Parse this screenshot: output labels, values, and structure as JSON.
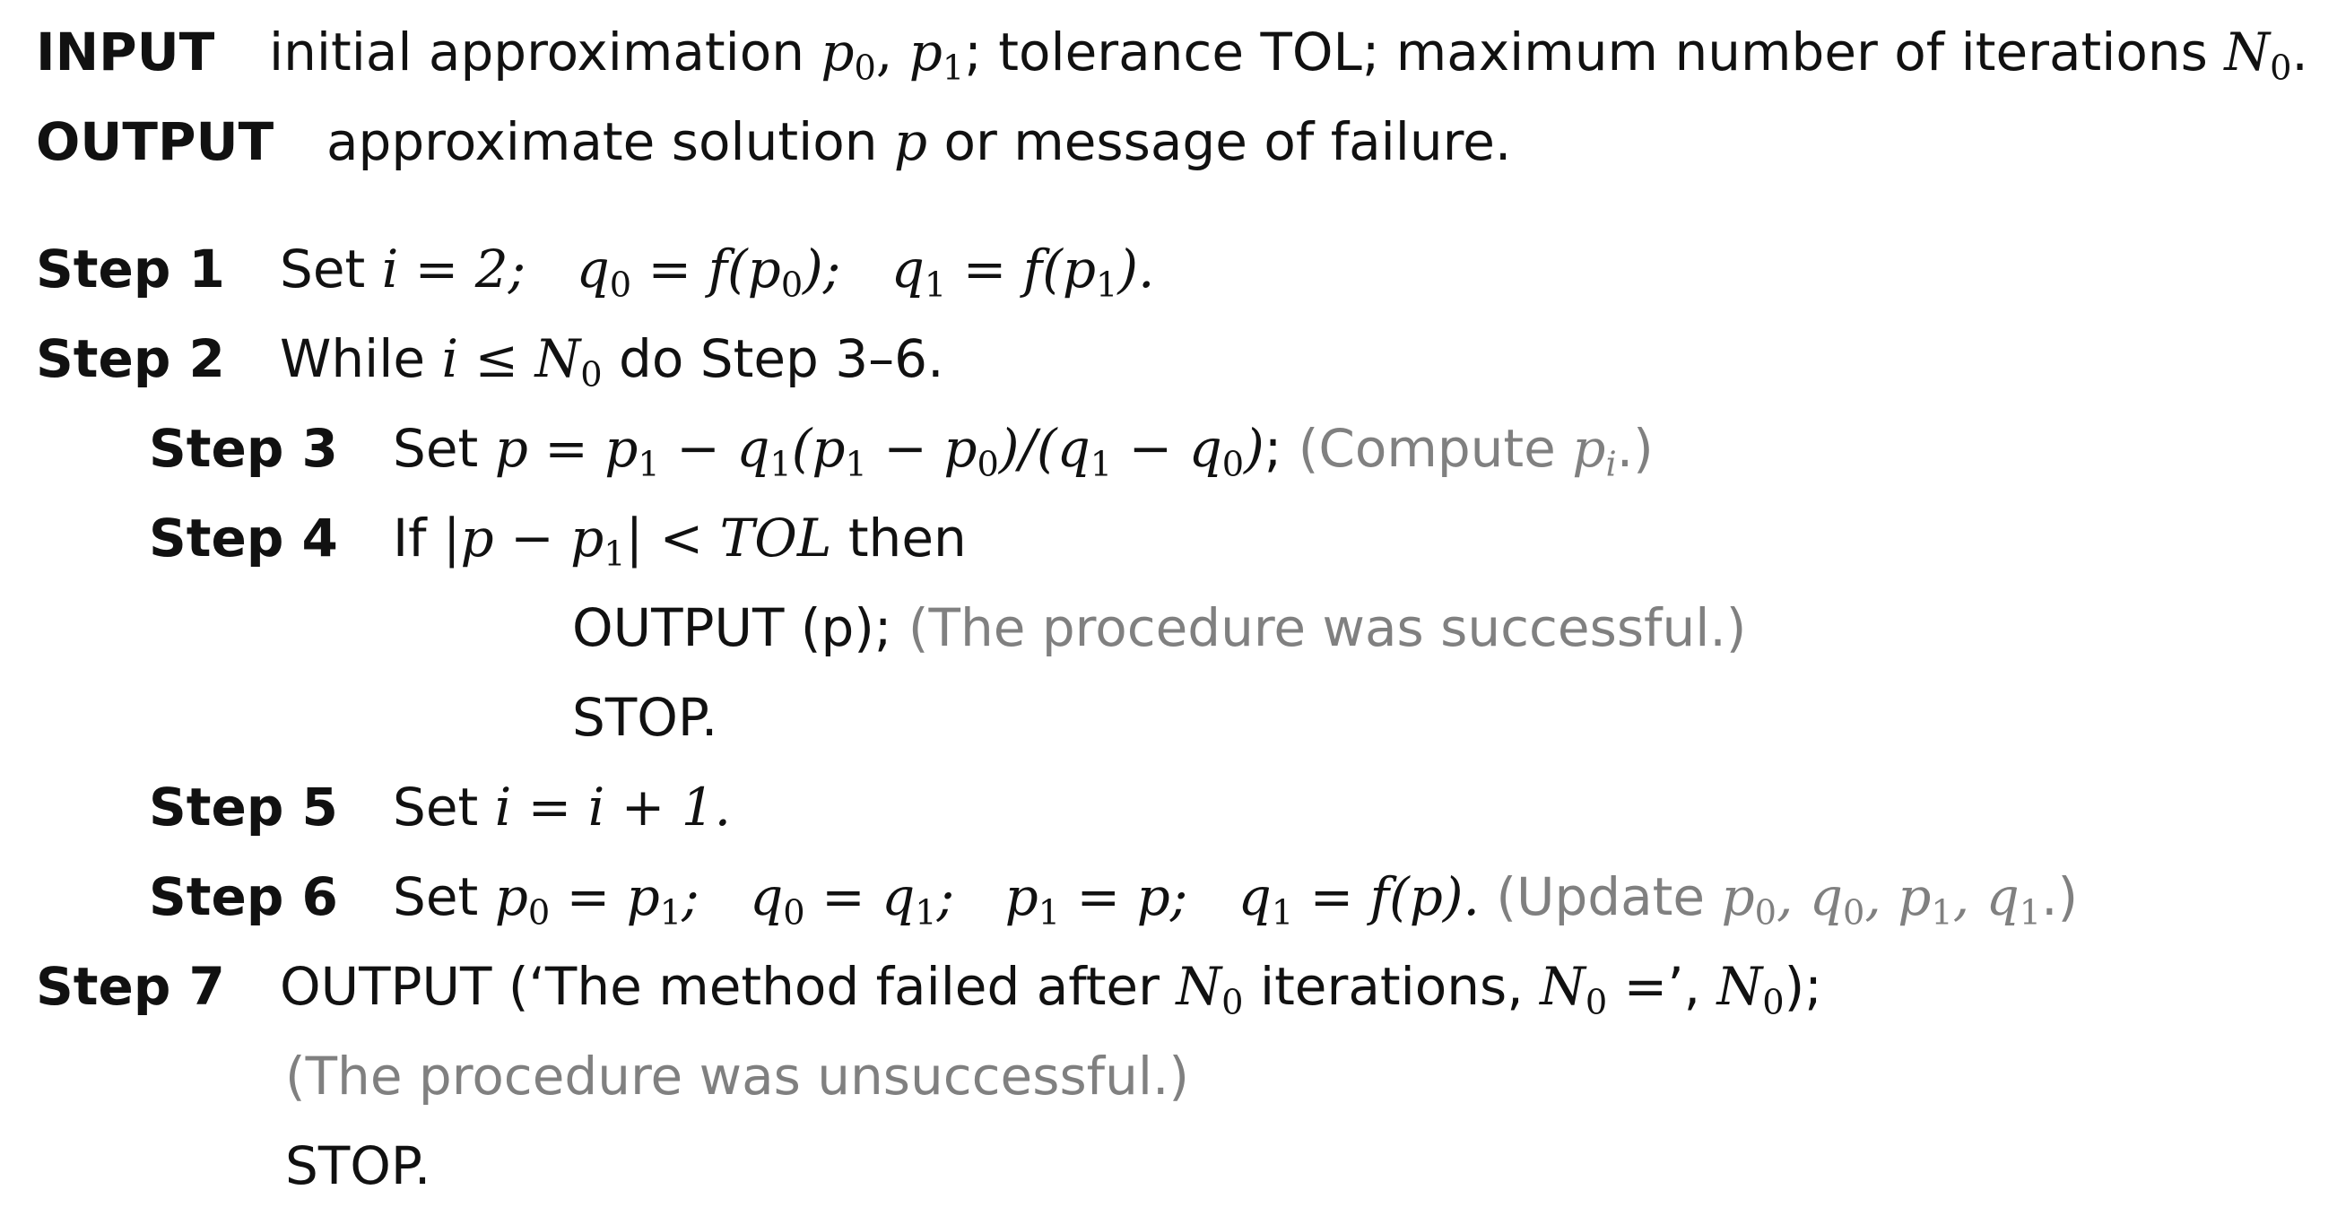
{
  "input": {
    "label": "INPUT",
    "text_a": "initial approximation",
    "p0": "p",
    "p0_sub": "0",
    "p1": "p",
    "p1_sub": "1",
    "text_b": "; tolerance TOL; maximum number of iterations",
    "n0": "N",
    "n0_sub": "0",
    "text_c": "."
  },
  "output": {
    "label": "OUTPUT",
    "text_a": "approximate solution",
    "p": "p",
    "text_b": "or message of failure."
  },
  "steps": {
    "s1": {
      "label": "Step 1",
      "set": "Set",
      "eq1": "i = 2;",
      "q0": "q",
      "q0_sub": "0",
      "eq2": " = f(",
      "p0": "p",
      "p0_sub": "0",
      "eq3": ");",
      "q1": "q",
      "q1_sub": "1",
      "eq4": " = f(",
      "p1": "p",
      "p1_sub": "1",
      "eq5": ")."
    },
    "s2": {
      "label": "Step 2",
      "text_a": "While",
      "cond": "i ≤ N",
      "cond_sub": "0",
      "text_b": "do Step 3–6."
    },
    "s3": {
      "label": "Step 3",
      "set": "Set",
      "expr": "p = p",
      "note": "(Compute",
      "note_var": "p",
      "note_sub": "i",
      "note_end": ".)"
    },
    "s4": {
      "label": "Step 4",
      "text_if": "If",
      "expr": "|p − p",
      "expr_sub": "1",
      "expr_b": "| < TOL",
      "text_then": "then",
      "out_line": "OUTPUT (p);",
      "out_note": "(The procedure was successful.)",
      "stop": "STOP."
    },
    "s5": {
      "label": "Step 5",
      "set": "Set",
      "expr": "i = i + 1."
    },
    "s6": {
      "label": "Step 6",
      "set": "Set",
      "note": "(Update",
      "note_end": ".)"
    },
    "s7": {
      "label": "Step 7",
      "text_a": "OUTPUT (‘The method failed after",
      "n0": "N",
      "n0_sub": "0",
      "text_b": "iterations,",
      "text_c": "=’,",
      "text_d": ");",
      "note": "(The procedure was unsuccessful.)",
      "stop": "STOP."
    }
  }
}
